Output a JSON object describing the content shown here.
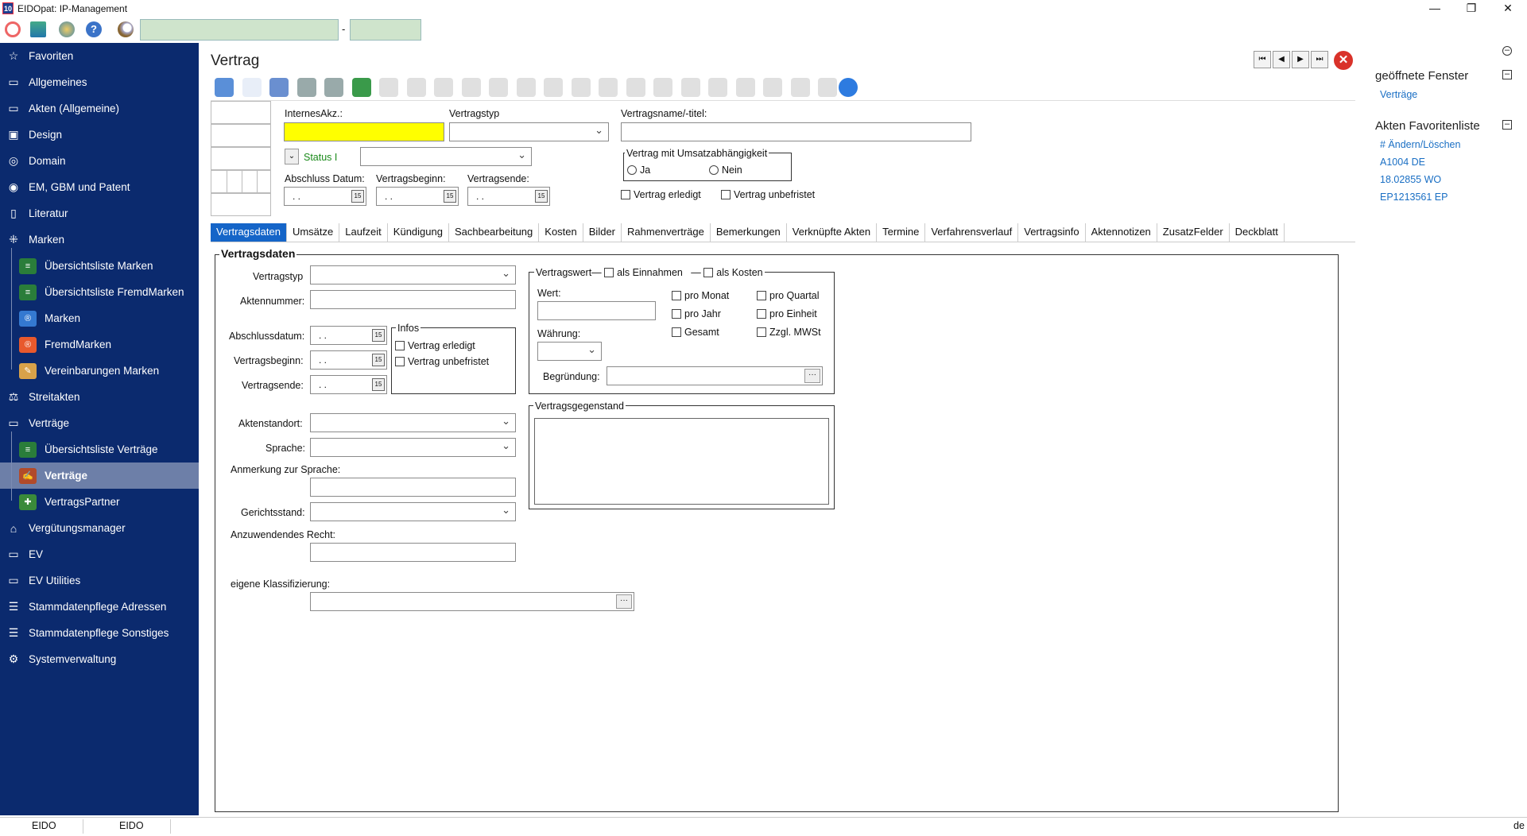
{
  "window": {
    "title": "EIDOpat: IP-Management",
    "app_icon": "10",
    "min": "—",
    "max": "❐",
    "close": "✕"
  },
  "toolbar_search": {
    "separator": "-"
  },
  "sidebar": {
    "items": [
      {
        "label": "Favoriten",
        "icon": "star-icon",
        "glyph": "☆"
      },
      {
        "label": "Allgemeines",
        "icon": "briefcase-icon",
        "glyph": "▭"
      },
      {
        "label": "Akten (Allgemeine)",
        "icon": "briefcase-icon",
        "glyph": "▭"
      },
      {
        "label": "Design",
        "icon": "image-icon",
        "glyph": "▣"
      },
      {
        "label": "Domain",
        "icon": "globe-icon",
        "glyph": "◎"
      },
      {
        "label": "EM, GBM und Patent",
        "icon": "seal-icon",
        "glyph": "◉"
      },
      {
        "label": "Literatur",
        "icon": "book-icon",
        "glyph": "▯"
      },
      {
        "label": "Marken",
        "icon": "network-icon",
        "glyph": "⁜"
      },
      {
        "label": "Übersichtsliste Marken",
        "icon": "list-icon",
        "glyph": "≡"
      },
      {
        "label": "Übersichtsliste FremdMarken",
        "icon": "list-icon",
        "glyph": "≡"
      },
      {
        "label": "Marken",
        "icon": "registered-icon",
        "glyph": "®"
      },
      {
        "label": "FremdMarken",
        "icon": "registered-icon",
        "glyph": "®"
      },
      {
        "label": "Vereinbarungen Marken",
        "icon": "agreement-icon",
        "glyph": "✎"
      },
      {
        "label": "Streitakten",
        "icon": "gavel-icon",
        "glyph": "⚖"
      },
      {
        "label": "Verträge",
        "icon": "contract-icon",
        "glyph": "▭"
      },
      {
        "label": "Übersichtsliste Verträge",
        "icon": "list-icon",
        "glyph": "≡"
      },
      {
        "label": "Verträge",
        "icon": "handshake-icon",
        "glyph": "✍"
      },
      {
        "label": "VertragsPartner",
        "icon": "people-icon",
        "glyph": "✚"
      },
      {
        "label": "Vergütungsmanager",
        "icon": "bank-icon",
        "glyph": "⌂"
      },
      {
        "label": "EV",
        "icon": "ev-icon",
        "glyph": "▭"
      },
      {
        "label": "EV Utilities",
        "icon": "ev-icon",
        "glyph": "▭"
      },
      {
        "label": "Stammdatenpflege Adressen",
        "icon": "database-icon",
        "glyph": "☰"
      },
      {
        "label": "Stammdatenpflege Sonstiges",
        "icon": "database-icon",
        "glyph": "☰"
      },
      {
        "label": "Systemverwaltung",
        "icon": "gear-icon",
        "glyph": "⚙"
      }
    ]
  },
  "header": {
    "title": "Vertrag",
    "nav": [
      "⏮",
      "◀",
      "▶",
      "⏭"
    ],
    "close": "✕"
  },
  "form": {
    "interneakz_label": "InternesAkz.:",
    "vertragstyp_label": "Vertragstyp",
    "vertragsname_label": "Vertragsname/-titel:",
    "status_label": "Status I",
    "umsatz_group": "Vertrag mit Umsatzabhängigkeit",
    "ja": "Ja",
    "nein": "Nein",
    "abschluss_label": "Abschluss Datum:",
    "beginn_label": "Vertragsbeginn:",
    "ende_label": "Vertragsende:",
    "date_empty": ". .",
    "erledigt": "Vertrag erledigt",
    "unbefristet": "Vertrag unbefristet"
  },
  "tabs": [
    "Vertragsdaten",
    "Umsätze",
    "Laufzeit",
    "Kündigung",
    "Sachbearbeitung",
    "Kosten",
    "Bilder",
    "Rahmenverträge",
    "Bemerkungen",
    "Verknüpfte Akten",
    "Termine",
    "Verfahrensverlauf",
    "Vertragsinfo",
    "Aktennotizen",
    "ZusatzFelder",
    "Deckblatt"
  ],
  "panel": {
    "title": "Vertragsdaten",
    "vertragstyp": "Vertragstyp",
    "aktennummer": "Aktennummer:",
    "abschlussdatum": "Abschlussdatum:",
    "vertragsbeginn": "Vertragsbeginn:",
    "vertragsende": "Vertragsende:",
    "infos": "Infos",
    "info_erledigt": "Vertrag erledigt",
    "info_unbefristet": "Vertrag unbefristet",
    "aktenstandort": "Aktenstandort:",
    "sprache": "Sprache:",
    "anmerkung": "Anmerkung zur Sprache:",
    "gerichtsstand": "Gerichtsstand:",
    "recht": "Anzuwendendes Recht:",
    "klassifizierung": "eigene Klassifizierung:",
    "vertragswert": "Vertragswert",
    "als_einnahmen": "als Einnahmen",
    "als_kosten": "als Kosten",
    "wert": "Wert:",
    "waehrung": "Währung:",
    "begruendung": "Begründung:",
    "pro_monat": "pro Monat",
    "pro_quartal": "pro Quartal",
    "pro_jahr": "pro Jahr",
    "pro_einheit": "pro Einheit",
    "gesamt": "Gesamt",
    "zzgl": "Zzgl. MWSt",
    "gegenstand": "Vertragsgegenstand",
    "ellipsis": "···"
  },
  "right_panel": {
    "open_windows_title": "geöffnete Fenster",
    "open_windows": [
      "Verträge"
    ],
    "fav_title": "Akten Favoritenliste",
    "fav_items": [
      "# Ändern/Löschen",
      "A1004 DE",
      "18.02855 WO",
      "EP1213561 EP"
    ]
  },
  "status_bar": {
    "cell1": "EIDO",
    "cell2": "EIDO",
    "lang": "de"
  },
  "colors": {
    "sidebar": "#0b2a6e",
    "active_tab": "#1565c8",
    "highlight_input": "#ffff00",
    "link": "#1a6fc4"
  }
}
